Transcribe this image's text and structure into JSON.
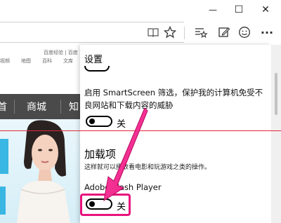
{
  "titlebar": {
    "minimize_glyph": "—",
    "maximize_glyph": "☐",
    "close_glyph": "✕"
  },
  "toolbar": {
    "icons": [
      "reading-view-icon",
      "favorite-star-icon",
      "favorites-hub-icon",
      "web-note-icon",
      "feedback-icon",
      "more-icon"
    ],
    "more_glyph": "···"
  },
  "webpage": {
    "top_links": "百度经验 | 百度",
    "sub_links": [
      "视频",
      "地图",
      "百科",
      "文库"
    ],
    "nav": [
      "首",
      "商城",
      "知"
    ]
  },
  "settings": {
    "title": "设置",
    "smartscreen_text_line1": "启用 SmartScreen 筛选，保护我的计算机免受不",
    "smartscreen_text_line2": "良网站和下载内容的威胁",
    "smartscreen_toggle_label": "关",
    "addons_heading": "加载项",
    "addons_description": "这样就可以播放看电影和玩游戏之类的操作。",
    "flash_label": "Adobe Flash Player",
    "flash_toggle_label": "关"
  },
  "colors": {
    "accent_pink": "#e8137e",
    "red_line": "#e0283a",
    "nav_bg": "#4a4a4a"
  }
}
